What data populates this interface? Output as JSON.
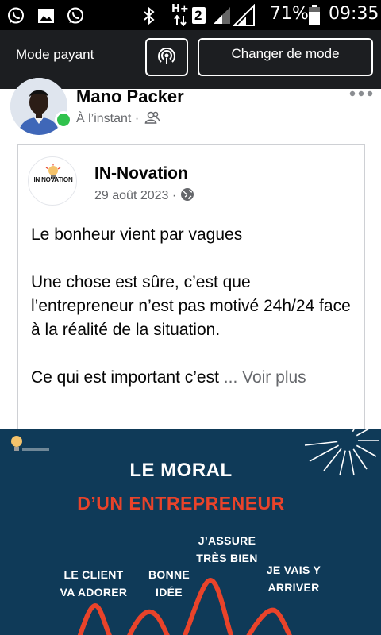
{
  "status_bar": {
    "battery": "71%",
    "time": "09:35",
    "network": "H+",
    "sim_slot": "2",
    "icons": [
      "whatsapp-icon",
      "gallery-icon",
      "whatsapp-icon",
      "bluetooth-icon",
      "data-arrows-icon",
      "sim-badge-icon",
      "signal-icon",
      "signal-icon",
      "battery-icon"
    ]
  },
  "top_bar": {
    "mode_label": "Mode payant",
    "change_mode_label": "Changer de mode",
    "podcast_icon": "broadcast-icon"
  },
  "post": {
    "author": "Mano Packer",
    "time": "À l’instant",
    "audience_icon": "friends-icon",
    "online": true,
    "menu_icon": "more-dots-icon"
  },
  "shared_post": {
    "page_name": "IN-Novation",
    "logo_text": "IN NOVATION",
    "date": "29 août 2023",
    "audience_icon": "globe-icon",
    "paragraphs": [
      "Le bonheur vient par vagues",
      "Une chose est sûre, c’est que l’entrepreneur n’est pas motivé 24h/24 face à la réalité de la situation.",
      "Ce qui est important c’est "
    ],
    "see_more": "... Voir plus"
  },
  "image": {
    "title_line1": "LE MORAL",
    "title_line2": "D’UN ENTREPRENEUR",
    "labels": [
      {
        "line1": "LE CLIENT",
        "line2": "VA ADORER"
      },
      {
        "line1": "BONNE",
        "line2": "IDÉE"
      },
      {
        "line1": "J’ASSURE",
        "line2": "TRÈS BIEN"
      },
      {
        "line1": "JE VAIS Y",
        "line2": "ARRIVER"
      }
    ],
    "colors": {
      "background": "#0f3a58",
      "accent": "#e9432a",
      "text": "#ffffff"
    }
  }
}
